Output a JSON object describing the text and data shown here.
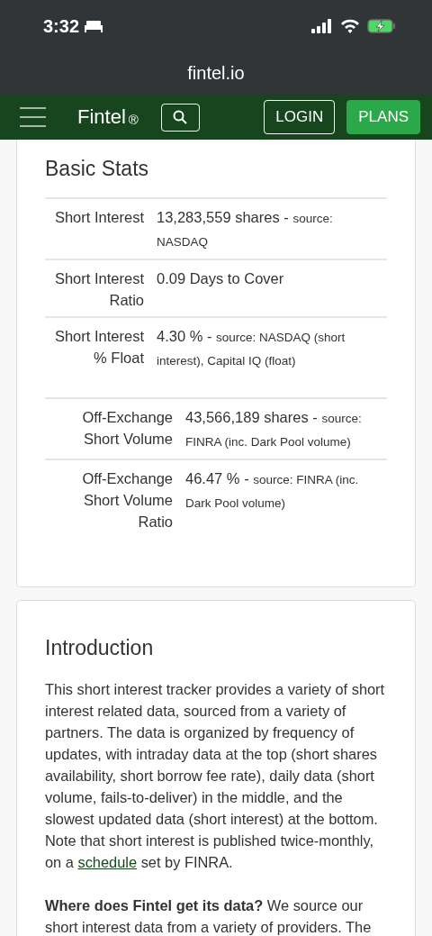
{
  "status_bar": {
    "time": "3:32"
  },
  "browser": {
    "url": "fintel.io"
  },
  "nav": {
    "brand": "Fintel",
    "brand_mark": "®",
    "buttons": [
      {
        "label": "LOGIN",
        "kind": "outline"
      },
      {
        "label": "PLANS",
        "kind": "primary"
      }
    ]
  },
  "basic_stats": {
    "title": "Basic Stats",
    "groups": [
      {
        "rows": [
          {
            "label": "Short Interest",
            "value": "13,283,559 shares -",
            "source": "source: NASDAQ"
          },
          {
            "label": "Short Interest Ratio",
            "value": "0.09 Days to Cover"
          },
          {
            "label": "Short Interest % Float",
            "value": "4.30 % -",
            "source": "source: NASDAQ (short interest), Capital IQ (float)"
          }
        ]
      },
      {
        "rows": [
          {
            "label": "Off-Exchange Short Volume",
            "value": "43,566,189 shares -",
            "source": "source: FINRA (inc. Dark Pool volume)"
          },
          {
            "label": "Off-Exchange Short Volume Ratio",
            "value": "46.47 % -",
            "source": "source: FINRA (inc. Dark Pool volume)"
          }
        ]
      }
    ]
  },
  "introduction": {
    "title": "Introduction",
    "paragraphs": [
      {
        "kind": "linked",
        "before": "This short interest tracker provides a variety of short interest related data, sourced from a variety of partners. The data is organized by frequency of updates, with intraday data at the top (short shares availability, short borrow fee rate), daily data (short volume, fails-to-deliver) in the middle, and the slowest updated data (short interest) at the bottom. Note that short interest is published twice-monthly, on a",
        "link": "schedule",
        "after": "set by FINRA."
      },
      {
        "kind": "rich",
        "text": "**Where does Fintel get its data?** We source our short interest data from a variety of providers. The"
      }
    ]
  }
}
